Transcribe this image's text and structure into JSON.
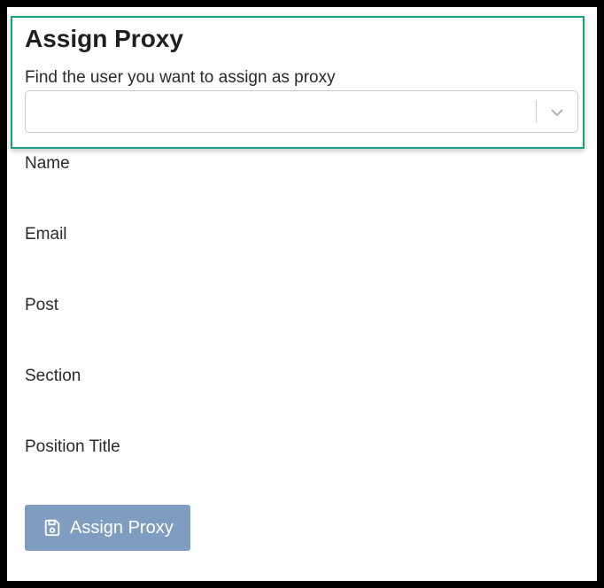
{
  "header": {
    "title": "Assign Proxy",
    "prompt": "Find the user you want to assign as proxy"
  },
  "user_select": {
    "value": "",
    "chevron_icon": "chevron-down-icon"
  },
  "fields": {
    "name_label": "Name",
    "email_label": "Email",
    "post_label": "Post",
    "section_label": "Section",
    "position_title_label": "Position Title"
  },
  "actions": {
    "assign_label": "Assign Proxy",
    "assign_icon": "save-icon",
    "assign_color": "#7f9dc1"
  },
  "colors": {
    "highlight_border": "#1aa383"
  }
}
